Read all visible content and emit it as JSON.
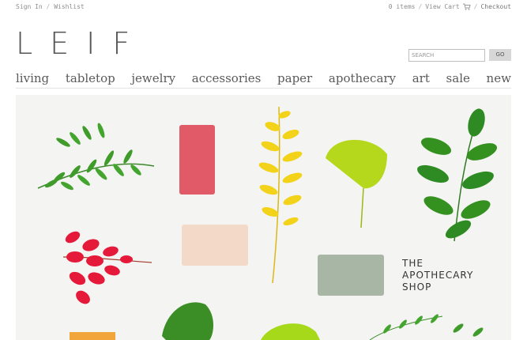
{
  "header": {
    "sign_in": "Sign In",
    "separator": "/",
    "wishlist": "Wishlist",
    "items_count": "0 items",
    "view_cart": "View Cart",
    "checkout": "Checkout"
  },
  "brand": {
    "logo": "LEIF"
  },
  "search": {
    "placeholder": "SEARCH",
    "go_label": "GO"
  },
  "nav": {
    "items": [
      "living",
      "tabletop",
      "jewelry",
      "accessories",
      "paper",
      "apothecary",
      "art",
      "sale",
      "new"
    ]
  },
  "hero": {
    "line1": "THE",
    "line2": "APOTHECARY",
    "line3": "SHOP"
  },
  "colors": {
    "accent_text": "#555555",
    "hero_background": "#f4f4f2",
    "soap_pink": "#e15a67",
    "soap_cream": "#f2d9c8",
    "soap_sage": "#a8b6a6",
    "soap_orange": "#f2a53b",
    "leaf_green": "#3f9b2a",
    "leaf_yellow": "#f3d21a",
    "leaf_red": "#e5193a"
  },
  "icons": {
    "cart": "cart-icon"
  }
}
